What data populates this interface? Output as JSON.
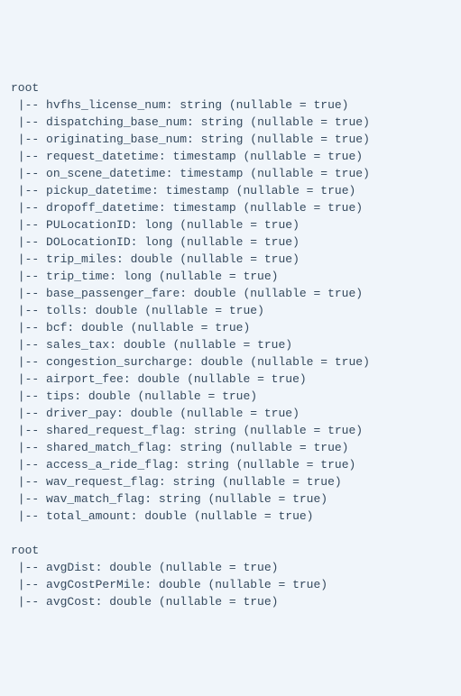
{
  "root_label": "root",
  "tree_prefix": " |-- ",
  "nullable_text": "(nullable = true)",
  "schemas": [
    {
      "fields": [
        {
          "name": "hvfhs_license_num",
          "type": "string"
        },
        {
          "name": "dispatching_base_num",
          "type": "string"
        },
        {
          "name": "originating_base_num",
          "type": "string"
        },
        {
          "name": "request_datetime",
          "type": "timestamp"
        },
        {
          "name": "on_scene_datetime",
          "type": "timestamp"
        },
        {
          "name": "pickup_datetime",
          "type": "timestamp"
        },
        {
          "name": "dropoff_datetime",
          "type": "timestamp"
        },
        {
          "name": "PULocationID",
          "type": "long"
        },
        {
          "name": "DOLocationID",
          "type": "long"
        },
        {
          "name": "trip_miles",
          "type": "double"
        },
        {
          "name": "trip_time",
          "type": "long"
        },
        {
          "name": "base_passenger_fare",
          "type": "double"
        },
        {
          "name": "tolls",
          "type": "double"
        },
        {
          "name": "bcf",
          "type": "double"
        },
        {
          "name": "sales_tax",
          "type": "double"
        },
        {
          "name": "congestion_surcharge",
          "type": "double"
        },
        {
          "name": "airport_fee",
          "type": "double"
        },
        {
          "name": "tips",
          "type": "double"
        },
        {
          "name": "driver_pay",
          "type": "double"
        },
        {
          "name": "shared_request_flag",
          "type": "string"
        },
        {
          "name": "shared_match_flag",
          "type": "string"
        },
        {
          "name": "access_a_ride_flag",
          "type": "string"
        },
        {
          "name": "wav_request_flag",
          "type": "string"
        },
        {
          "name": "wav_match_flag",
          "type": "string"
        },
        {
          "name": "total_amount",
          "type": "double"
        }
      ]
    },
    {
      "fields": [
        {
          "name": "avgDist",
          "type": "double"
        },
        {
          "name": "avgCostPerMile",
          "type": "double"
        },
        {
          "name": "avgCost",
          "type": "double"
        }
      ]
    }
  ]
}
